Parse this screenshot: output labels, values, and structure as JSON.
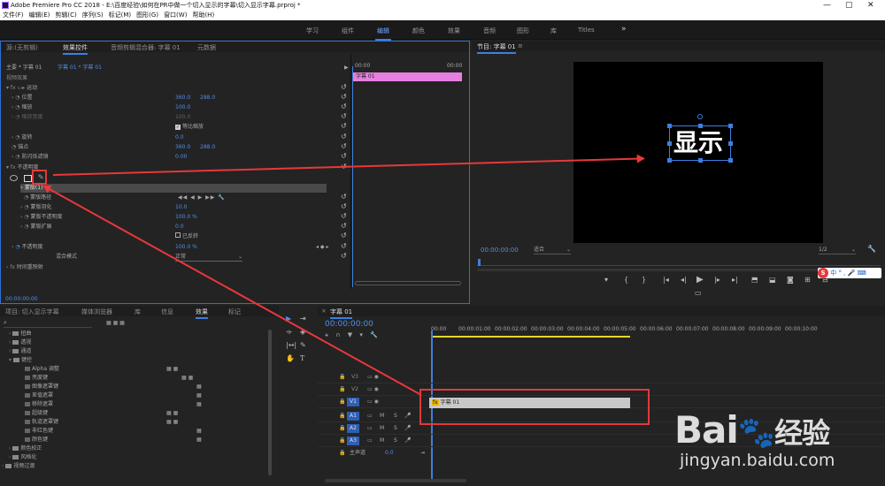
{
  "app": {
    "title": "Adobe Premiere Pro CC 2018 - E:\\百度经验\\如何在PR中做一个切入显示的字幕\\切入显示字幕.prproj *",
    "min": "—",
    "max": "▢",
    "close": "✕"
  },
  "menu": [
    "文件(F)",
    "编辑(E)",
    "剪辑(C)",
    "序列(S)",
    "标记(M)",
    "图形(G)",
    "窗口(W)",
    "帮助(H)"
  ],
  "workspaces": [
    {
      "label": "学习",
      "active": false
    },
    {
      "label": "组件",
      "active": false
    },
    {
      "label": "编辑",
      "active": true
    },
    {
      "label": "颜色",
      "active": false
    },
    {
      "label": "效果",
      "active": false
    },
    {
      "label": "音频",
      "active": false
    },
    {
      "label": "图形",
      "active": false
    },
    {
      "label": "库",
      "active": false
    },
    {
      "label": "Titles",
      "active": false
    }
  ],
  "workspace_more": "»",
  "effect_controls": {
    "tabs": [
      "源:(无剪辑)",
      "效果控件",
      "音频剪辑混合器: 字幕 01",
      "元数据"
    ],
    "source": "主要 * 字幕 01",
    "seq_clip": "字幕 01 * 字幕 01",
    "tl_start": "00:00",
    "tl_end": "00:00",
    "clip_label": "字幕 01",
    "video_effects": "视频效果",
    "motion": "运动",
    "position": {
      "label": "位置",
      "x": "360.0",
      "y": "288.0"
    },
    "scale": {
      "label": "缩放",
      "value": "100.0"
    },
    "scale_width": {
      "label": "缩放宽度",
      "value": "100.0"
    },
    "uniform_scale": "等比缩放",
    "rotation": {
      "label": "旋转",
      "value": "0.0"
    },
    "anchor": {
      "label": "锚点",
      "x": "360.0",
      "y": "288.0"
    },
    "anti_flicker": {
      "label": "防闪烁滤镜",
      "value": "0.00"
    },
    "opacity": "不透明度",
    "mask": "蒙版(1)",
    "mask_path": "蒙版路径",
    "mask_feather": {
      "label": "蒙版羽化",
      "value": "10.0"
    },
    "mask_opacity": {
      "label": "蒙版不透明度",
      "value": "100.0 %"
    },
    "mask_expansion": {
      "label": "蒙版扩展",
      "value": "0.0"
    },
    "inverted": "已反转",
    "opacity_value": {
      "label": "不透明度",
      "value": "100.0 %"
    },
    "blend": {
      "label": "混合模式",
      "value": "正常"
    },
    "time_remap": "时间重映射",
    "timecode": "00:00:00:00",
    "mask_controls": "◀◀  ◀  ▶  ▶▶  🔧"
  },
  "program": {
    "title": "节目: 字幕 01",
    "caption": "显示",
    "timecode": "00:00:00:00",
    "fit": "适合",
    "quality": "1/2",
    "ime": "中 ° , 🎤 ⌨"
  },
  "project": {
    "tabs": [
      "项目: 切入显示字幕",
      "媒体浏览器",
      "库",
      "信息",
      "效果",
      "标记"
    ],
    "items": [
      {
        "label": "扭曲",
        "indent": 1,
        "open": false,
        "badges": 0
      },
      {
        "label": "透视",
        "indent": 1,
        "open": false,
        "badges": 0
      },
      {
        "label": "通道",
        "indent": 1,
        "open": false,
        "badges": 0
      },
      {
        "label": "键控",
        "indent": 1,
        "open": true,
        "badges": 0
      },
      {
        "label": "Alpha 调整",
        "indent": 2,
        "open": null,
        "badges": 2
      },
      {
        "label": "亮度键",
        "indent": 2,
        "open": null,
        "badges": 2
      },
      {
        "label": "图像遮罩键",
        "indent": 2,
        "open": null,
        "badges": 1
      },
      {
        "label": "差值遮罩",
        "indent": 2,
        "open": null,
        "badges": 1
      },
      {
        "label": "移除遮罩",
        "indent": 2,
        "open": null,
        "badges": 1
      },
      {
        "label": "超级键",
        "indent": 2,
        "open": null,
        "badges": 2
      },
      {
        "label": "轨道遮罩键",
        "indent": 2,
        "open": null,
        "badges": 2
      },
      {
        "label": "非红色键",
        "indent": 2,
        "open": null,
        "badges": 1
      },
      {
        "label": "颜色键",
        "indent": 2,
        "open": null,
        "badges": 1
      },
      {
        "label": "颜色校正",
        "indent": 1,
        "open": false,
        "badges": 0
      },
      {
        "label": "风格化",
        "indent": 1,
        "open": false,
        "badges": 0
      },
      {
        "label": "视频过渡",
        "indent": 0,
        "open": false,
        "badges": 0
      }
    ]
  },
  "timeline": {
    "tab": "字幕 01",
    "timecode": "00:00:00:00",
    "ruler": [
      "00:00",
      "00:00:01:00",
      "00:00:02:00",
      "00:00:03:00",
      "00:00:04:00",
      "00:00:05:00",
      "00:00:06:00",
      "00:00:07:00",
      "00:00:08:00",
      "00:00:09:00",
      "00:00:10:00"
    ],
    "tracks": [
      {
        "id": "V3",
        "kind": "v"
      },
      {
        "id": "V2",
        "kind": "v"
      },
      {
        "id": "V1",
        "kind": "v",
        "active": true
      },
      {
        "id": "A1",
        "kind": "a",
        "active": true
      },
      {
        "id": "A2",
        "kind": "a",
        "active": true
      },
      {
        "id": "A3",
        "kind": "a",
        "active": true
      }
    ],
    "master": {
      "label": "主声道",
      "value": "0.0"
    },
    "clip": {
      "label": "字幕 01",
      "fx": "fx"
    },
    "toggle_track": "切换轨道输出",
    "mute": "M",
    "solo": "S"
  },
  "watermark": {
    "brand": "Bai",
    "paw": "🐾",
    "du": "经验",
    "site": "jingyan.baidu.com"
  }
}
